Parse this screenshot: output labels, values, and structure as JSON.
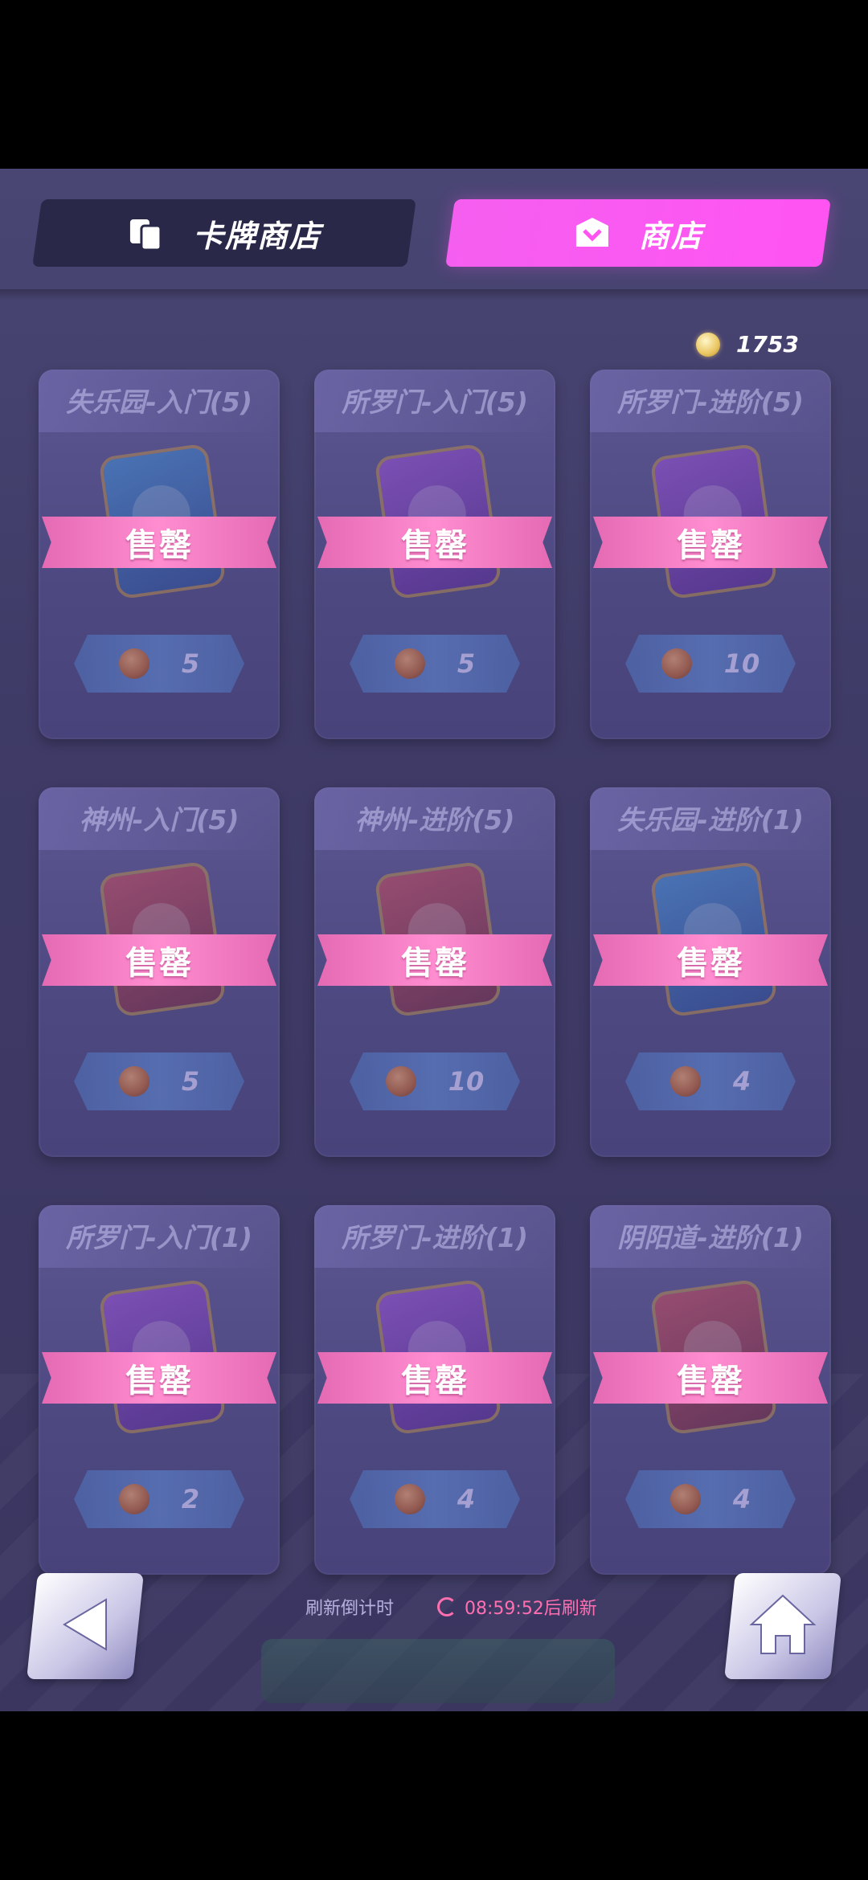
{
  "tabs": [
    {
      "label": "卡牌商店",
      "active": false,
      "icon": "cards-icon"
    },
    {
      "label": "商店",
      "active": true,
      "icon": "shop-icon"
    }
  ],
  "currency": {
    "value": "1753",
    "icon": "gold-coin-icon"
  },
  "items": [
    {
      "title": "失乐园-入门(5)",
      "status": "售罄",
      "price": "5",
      "pack_color": "blue"
    },
    {
      "title": "所罗门-入门(5)",
      "status": "售罄",
      "price": "5",
      "pack_color": "purple"
    },
    {
      "title": "所罗门-进阶(5)",
      "status": "售罄",
      "price": "10",
      "pack_color": "purple"
    },
    {
      "title": "神州-入门(5)",
      "status": "售罄",
      "price": "5",
      "pack_color": "red"
    },
    {
      "title": "神州-进阶(5)",
      "status": "售罄",
      "price": "10",
      "pack_color": "red"
    },
    {
      "title": "失乐园-进阶(1)",
      "status": "售罄",
      "price": "4",
      "pack_color": "blue"
    },
    {
      "title": "所罗门-入门(1)",
      "status": "售罄",
      "price": "2",
      "pack_color": "purple"
    },
    {
      "title": "所罗门-进阶(1)",
      "status": "售罄",
      "price": "4",
      "pack_color": "purple"
    },
    {
      "title": "阴阳道-进阶(1)",
      "status": "售罄",
      "price": "4",
      "pack_color": "red"
    }
  ],
  "refresh": {
    "label": "刷新倒计时",
    "time": "08:59:52后刷新"
  }
}
